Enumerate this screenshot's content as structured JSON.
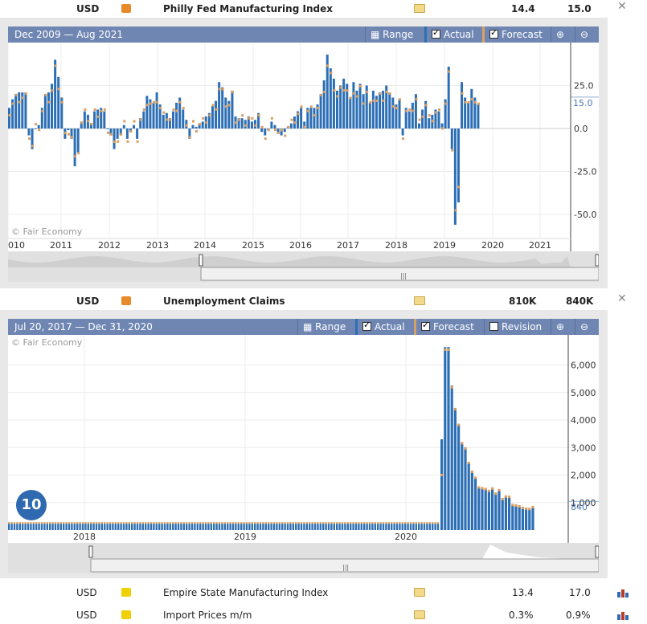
{
  "events": [
    {
      "currency": "USD",
      "name": "Philly Fed Manufacturing Index",
      "actual": "14.4",
      "forecast": "15.0",
      "impact_color": "#e8892a"
    },
    {
      "currency": "USD",
      "name": "Unemployment Claims",
      "actual": "810K",
      "forecast": "840K",
      "impact_color": "#e8892a"
    },
    {
      "currency": "USD",
      "name": "Empire State Manufacturing Index",
      "actual": "13.4",
      "forecast": "17.0",
      "impact_color": "#f0d000"
    },
    {
      "currency": "USD",
      "name": "Import Prices m/m",
      "actual": "0.3%",
      "forecast": "0.9%",
      "impact_color": "#f0d000"
    }
  ],
  "toolbar": {
    "range_label": "Range",
    "actual_label": "Actual",
    "forecast_label": "Forecast",
    "revision_label": "Revision"
  },
  "watermark": "© Fair Economy",
  "badge": "10",
  "colors": {
    "titlebar": "#6f86b3",
    "actual_bar": "#2d6fb5",
    "forecast_marker": "#d9a064"
  },
  "chart_data": [
    {
      "type": "bar",
      "range_text": "Dec 2009 — Aug 2021",
      "x_tick_labels": [
        "010",
        "2011",
        "2012",
        "2013",
        "2014",
        "2015",
        "2016",
        "2017",
        "2018",
        "2019",
        "2020",
        "2021"
      ],
      "y_tick_labels": [
        "25.0",
        "0.0",
        "-25.0",
        "-50.0"
      ],
      "ylim": [
        -64,
        50
      ],
      "current_label": "15.0",
      "actual": [
        12,
        17,
        20,
        21,
        21,
        21,
        -4,
        -12,
        0,
        2,
        12,
        20,
        21,
        26,
        40,
        30,
        18,
        -6,
        -1,
        -6,
        -22,
        -14,
        4,
        10,
        8,
        3,
        10,
        11,
        12,
        10,
        0,
        -4,
        -12,
        -6,
        -4,
        2,
        -6,
        -2,
        2,
        -6,
        6,
        10,
        19,
        17,
        15,
        21,
        14,
        8,
        9,
        6,
        10,
        15,
        18,
        11,
        5,
        -6,
        2,
        1,
        3,
        4,
        7,
        9,
        13,
        16,
        27,
        24,
        18,
        16,
        22,
        7,
        6,
        6,
        5,
        7,
        4,
        5,
        9,
        -2,
        -4,
        -1,
        4,
        2,
        -3,
        -4,
        -2,
        1,
        3,
        7,
        10,
        12,
        4,
        12,
        12,
        12,
        14,
        20,
        28,
        43,
        35,
        29,
        22,
        25,
        29,
        26,
        18,
        27,
        22,
        26,
        20,
        25,
        15,
        22,
        19,
        21,
        22,
        25,
        21,
        18,
        14,
        17,
        -4,
        12,
        10,
        15,
        20,
        3,
        11,
        16,
        6,
        8,
        11,
        10,
        3,
        17,
        36,
        -12,
        -56,
        -43,
        27,
        18,
        15,
        23,
        18,
        14
      ]
    },
    {
      "type": "bar",
      "range_text": "Jul 20, 2017 — Dec 31, 2020",
      "x_tick_labels": [
        "2018",
        "2019",
        "2020"
      ],
      "y_tick_labels": [
        "6,000",
        "5,000",
        "4,000",
        "3,000",
        "2,000",
        "1,000"
      ],
      "ylim": [
        0,
        6700
      ],
      "current_label": "840",
      "spike_actual": [
        3300,
        6650,
        6650,
        5250,
        4440,
        3860,
        3180,
        2990,
        2450,
        2120,
        1900,
        1540,
        1510,
        1480,
        1410,
        1500,
        1310,
        1440,
        1110,
        1200,
        1190,
        890,
        870,
        840,
        780,
        755,
        740,
        810
      ]
    }
  ]
}
